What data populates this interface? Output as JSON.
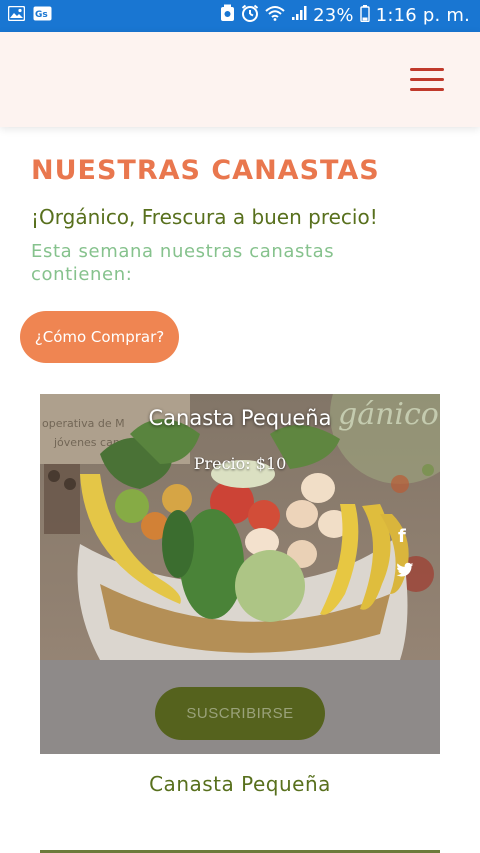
{
  "status_bar": {
    "left_icons": [
      "image-icon",
      "translate-icon"
    ],
    "right_icons": [
      "nfc-icon",
      "alarm-icon",
      "wifi-icon",
      "signal-icon"
    ],
    "battery_percent": "23%",
    "time": "1:16 p. m."
  },
  "header": {
    "menu_icon": "hamburger-icon",
    "menu_color": "#c0392b",
    "background": "#fdf3f0"
  },
  "main": {
    "title": "NUESTRAS CANASTAS",
    "subtitle": "¡Orgánico, Frescura a buen precio!",
    "contents_text": "Esta semana nuestras canastas contienen:",
    "how_to_buy_label": "¿Cómo Comprar?"
  },
  "product": {
    "title": "Canasta Pequeña",
    "price": "Precio: $10",
    "subscribe_label": "SUSCRIBIRSE",
    "name_below": "Canasta Pequeña",
    "social_icons": [
      "facebook-icon",
      "twitter-icon"
    ]
  },
  "colors": {
    "status_bar": "#1976d2",
    "title": "#e9774e",
    "subtitle": "#58701d",
    "contents_text": "#86c28d",
    "how_button": "#ef8552",
    "subscribe_button": "#55621d"
  }
}
